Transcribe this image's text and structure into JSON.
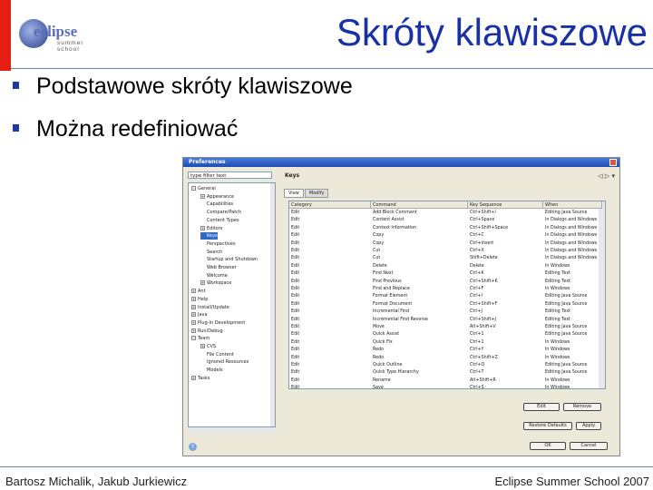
{
  "slide": {
    "title": "Skróty klawiszowe",
    "logo_word": "eclipse",
    "logo_sub": "summer school",
    "bullets": [
      "Podstawowe skróty klawiszowe",
      "Można redefiniować"
    ],
    "footer_left": "Bartosz Michalik, Jakub Jurkiewicz",
    "footer_right": "Eclipse Summer School 2007",
    "colors": {
      "accent": "#e21f12",
      "title": "#1a31a6",
      "bullet": "#1d3aa0"
    }
  },
  "dialog": {
    "title": "Preferences",
    "filter_value": "type filter text",
    "pane_title": "Keys",
    "tabs": [
      "View",
      "Modify"
    ],
    "tree": [
      {
        "label": "General",
        "level": 0,
        "exp": "−"
      },
      {
        "label": "Appearance",
        "level": 1,
        "exp": "+"
      },
      {
        "label": "Capabilities",
        "level": 1
      },
      {
        "label": "Compare/Patch",
        "level": 1
      },
      {
        "label": "Content Types",
        "level": 1
      },
      {
        "label": "Editors",
        "level": 1,
        "exp": "+"
      },
      {
        "label": "Keys",
        "level": 1,
        "selected": true
      },
      {
        "label": "Perspectives",
        "level": 1
      },
      {
        "label": "Search",
        "level": 1
      },
      {
        "label": "Startup and Shutdown",
        "level": 1
      },
      {
        "label": "Web Browser",
        "level": 1
      },
      {
        "label": "Welcome",
        "level": 1
      },
      {
        "label": "Workspace",
        "level": 1,
        "exp": "+"
      },
      {
        "label": "Ant",
        "level": 0,
        "exp": "+"
      },
      {
        "label": "Help",
        "level": 0,
        "exp": "+"
      },
      {
        "label": "Install/Update",
        "level": 0,
        "exp": "+"
      },
      {
        "label": "Java",
        "level": 0,
        "exp": "+"
      },
      {
        "label": "Plug-in Development",
        "level": 0,
        "exp": "+"
      },
      {
        "label": "Run/Debug",
        "level": 0,
        "exp": "+"
      },
      {
        "label": "Team",
        "level": 0,
        "exp": "−"
      },
      {
        "label": "CVS",
        "level": 1,
        "exp": "+"
      },
      {
        "label": "File Content",
        "level": 1
      },
      {
        "label": "Ignored Resources",
        "level": 1
      },
      {
        "label": "Models",
        "level": 1
      },
      {
        "label": "Tasks",
        "level": 0,
        "exp": "+"
      }
    ],
    "columns": [
      "Category",
      "Command",
      "Key Sequence",
      "When"
    ],
    "rows": [
      [
        "Edit",
        "Add Block Comment",
        "Ctrl+Shift+/",
        "Editing Java Source"
      ],
      [
        "Edit",
        "Content Assist",
        "Ctrl+Space",
        "In Dialogs and Windows"
      ],
      [
        "Edit",
        "Context Information",
        "Ctrl+Shift+Space",
        "In Dialogs and Windows"
      ],
      [
        "Edit",
        "Copy",
        "Ctrl+C",
        "In Dialogs and Windows"
      ],
      [
        "Edit",
        "Copy",
        "Ctrl+Insert",
        "In Dialogs and Windows"
      ],
      [
        "Edit",
        "Cut",
        "Ctrl+X",
        "In Dialogs and Windows"
      ],
      [
        "Edit",
        "Cut",
        "Shift+Delete",
        "In Dialogs and Windows"
      ],
      [
        "Edit",
        "Delete",
        "Delete",
        "In Windows"
      ],
      [
        "Edit",
        "Find Next",
        "Ctrl+K",
        "Editing Text"
      ],
      [
        "Edit",
        "Find Previous",
        "Ctrl+Shift+K",
        "Editing Text"
      ],
      [
        "Edit",
        "Find and Replace",
        "Ctrl+F",
        "In Windows"
      ],
      [
        "Edit",
        "Format Element",
        "Ctrl+I",
        "Editing Java Source"
      ],
      [
        "Edit",
        "Format Document",
        "Ctrl+Shift+F",
        "Editing Java Source"
      ],
      [
        "Edit",
        "Incremental Find",
        "Ctrl+J",
        "Editing Text"
      ],
      [
        "Edit",
        "Incremental Find Reverse",
        "Ctrl+Shift+J",
        "Editing Text"
      ],
      [
        "Edit",
        "Move",
        "Alt+Shift+V",
        "Editing Java Source"
      ],
      [
        "Edit",
        "Quick Assist",
        "Ctrl+1",
        "Editing Java Source"
      ],
      [
        "Edit",
        "Quick Fix",
        "Ctrl+1",
        "In Windows"
      ],
      [
        "Edit",
        "Redo",
        "Ctrl+Y",
        "In Windows"
      ],
      [
        "Edit",
        "Redo",
        "Ctrl+Shift+Z",
        "In Windows"
      ],
      [
        "Edit",
        "Quick Outline",
        "Ctrl+O",
        "Editing Java Source"
      ],
      [
        "Edit",
        "Quick Type Hierarchy",
        "Ctrl+T",
        "Editing Java Source"
      ],
      [
        "Edit",
        "Rename",
        "Alt+Shift+R",
        "In Windows"
      ],
      [
        "Edit",
        "Save",
        "Ctrl+S",
        "In Windows"
      ],
      [
        "Edit",
        "Remove Block Comment",
        "Ctrl+Shift+\\",
        "Editing Java Source"
      ],
      [
        "Edit",
        "Restore Last Selection",
        "Alt+Shift+Down",
        "Editing Java Source"
      ]
    ],
    "buttons": {
      "edit": "Edit",
      "remove": "Remove",
      "restore_defaults": "Restore Defaults",
      "apply": "Apply",
      "ok": "OK",
      "cancel": "Cancel"
    },
    "help": "?"
  }
}
